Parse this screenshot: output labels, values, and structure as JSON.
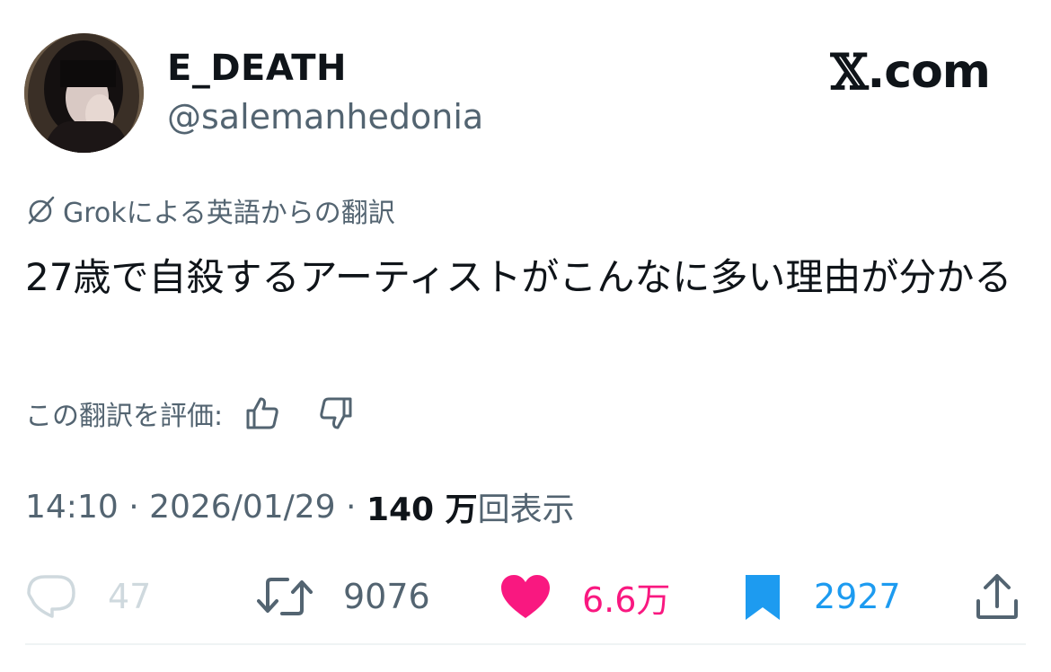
{
  "author": {
    "display_name": "E_DEATH",
    "handle": "@salemanhedonia"
  },
  "brand": {
    "x_mark": "𝕏",
    "text": ".com"
  },
  "translation": {
    "icon": "slash-circle-icon",
    "label": "Grokによる英語からの翻訳"
  },
  "tweet": {
    "text": "27歳で自殺するアーティストがこんなに多い理由が分かる"
  },
  "rating": {
    "label": "この翻訳を評価:",
    "up_icon": "thumbs-up-icon",
    "down_icon": "thumbs-down-icon"
  },
  "meta": {
    "time": "14:10",
    "separator": " · ",
    "date": "2026/01/29",
    "views_count": "140 万",
    "views_label": "回表示"
  },
  "actions": {
    "reply_count": "47",
    "retweet_count": "9076",
    "like_count": "6.6万",
    "bookmark_count": "2927"
  },
  "colors": {
    "like": "#f91880",
    "bookmark": "#1d9bf0",
    "muted": "#536471",
    "faded": "#cfd9de"
  }
}
